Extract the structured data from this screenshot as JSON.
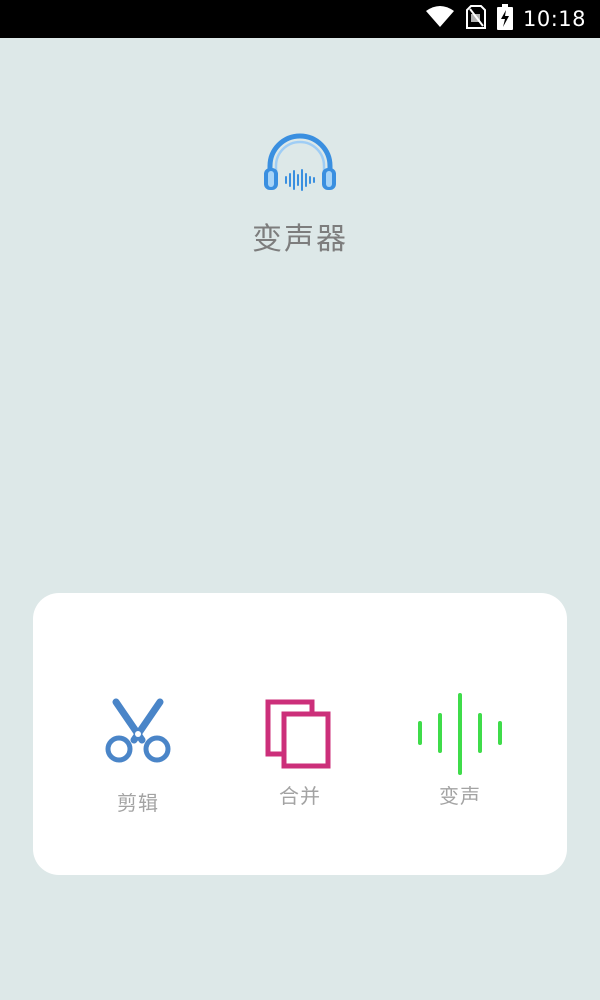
{
  "status_bar": {
    "time": "10:18",
    "icons": [
      "wifi-icon",
      "no-sim-icon",
      "battery-charging-icon"
    ],
    "background": "#000000"
  },
  "app": {
    "title": "变声器",
    "logo_icon": "headphones-waveform-icon",
    "accent": "#3a8fe0"
  },
  "actions": [
    {
      "label": "剪辑",
      "icon": "scissors-icon",
      "color": "#4a85c8"
    },
    {
      "label": "合并",
      "icon": "merge-icon",
      "color": "#cc2f7a"
    },
    {
      "label": "变声",
      "icon": "sound-wave-icon",
      "color": "#3fdc4a"
    }
  ],
  "theme": {
    "background": "#dde8e8",
    "card": "#ffffff",
    "label_color": "#a3a3a3",
    "title_color": "#7d7d7d"
  }
}
